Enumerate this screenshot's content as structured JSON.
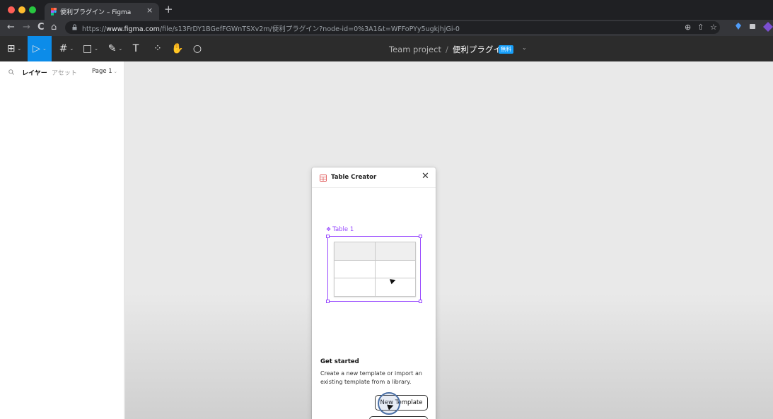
{
  "browser": {
    "tab_title": "便利プラグイン – Figma",
    "tab_close": "×",
    "new_tab": "+",
    "nav": {
      "back": "←",
      "forward": "→",
      "reload": "C",
      "home": "⌂"
    },
    "url_prefix": "https://",
    "url_domain": "www.figma.com",
    "url_path": "/file/s13FrDY1BGefFGWnTSXv2m/便利プラグイン?node-id=0%3A1&t=WFFoPYy5ugkjhjGi-0",
    "omni_icons": {
      "zoom": "⊕",
      "share": "⇧",
      "bookmark": "☆"
    },
    "colors": {
      "tabstrip": "#1f2023",
      "toolbar": "#35363a",
      "close": "#ff5f57",
      "minimize": "#febc2e",
      "maximize": "#28c840"
    }
  },
  "toolbar": {
    "tools": [
      {
        "name": "main-menu",
        "glyph": "⊞"
      },
      {
        "name": "move-tool",
        "glyph": "▷"
      },
      {
        "name": "frame-tool",
        "glyph": "#"
      },
      {
        "name": "shape-tool",
        "glyph": "□"
      },
      {
        "name": "pen-tool",
        "glyph": "✎"
      },
      {
        "name": "text-tool",
        "glyph": "T"
      },
      {
        "name": "resources-tool",
        "glyph": "⁘"
      },
      {
        "name": "hand-tool",
        "glyph": "✋"
      },
      {
        "name": "comment-tool",
        "glyph": "○"
      }
    ],
    "caret": "⌄",
    "project": "Team project",
    "separator": "/",
    "file": "便利プラグイン",
    "plan_badge": "無料",
    "file_caret": "⌄",
    "accent": "#0c8ce9"
  },
  "left_panel": {
    "layers_tab": "レイヤー",
    "assets_tab": "アセット",
    "page": "Page 1",
    "page_caret": "⌄"
  },
  "plugin": {
    "title": "Table Creator",
    "close": "✕",
    "component_label": "Table 1",
    "component_glyph": "❖",
    "table_rows": 3,
    "table_cols": 2,
    "get_started_title": "Get started",
    "get_started_desc": "Create a new template or import an existing template from a library.",
    "new_template_button": "New Template",
    "accent": "#9747ff"
  }
}
